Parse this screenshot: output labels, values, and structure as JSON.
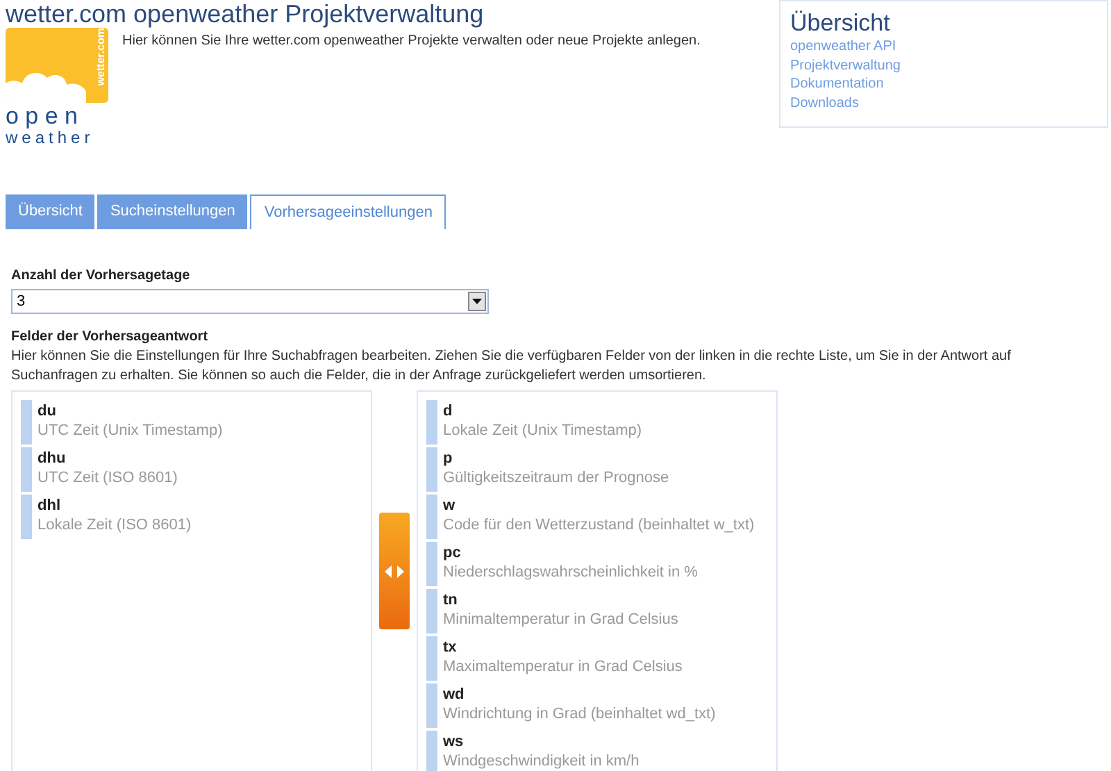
{
  "header": {
    "title": "wetter.com openweather Projektverwaltung",
    "intro": "Hier können Sie Ihre wetter.com openweather Projekte verwalten oder neue Projekte anlegen.",
    "logo": {
      "side_text": "wetter.com",
      "line_1": "o p e n",
      "line_2": "weather"
    }
  },
  "overview": {
    "title": "Übersicht",
    "links": [
      "openweather API",
      "Projektverwaltung",
      "Dokumentation",
      "Downloads"
    ]
  },
  "tabs": [
    {
      "label": "Übersicht",
      "selected": false
    },
    {
      "label": "Sucheinstellungen",
      "selected": false
    },
    {
      "label": "Vorhersageeinstellungen",
      "selected": true
    }
  ],
  "days": {
    "label": "Anzahl der Vorhersagetage",
    "value": "3"
  },
  "fields": {
    "title": "Felder der Vorhersageantwort",
    "description": "Hier können Sie die Einstellungen für Ihre Suchabfragen bearbeiten. Ziehen Sie die verfügbaren Felder von der linken in die rechte Liste, um Sie in der Antwort auf Suchanfragen zu erhalten. Sie können so auch die Felder, die in der Anfrage zurückgeliefert werden umsortieren.",
    "available": [
      {
        "code": "du",
        "label": "UTC Zeit (Unix Timestamp)"
      },
      {
        "code": "dhu",
        "label": "UTC Zeit (ISO 8601)"
      },
      {
        "code": "dhl",
        "label": "Lokale Zeit (ISO 8601)"
      }
    ],
    "chosen": [
      {
        "code": "d",
        "label": "Lokale Zeit (Unix Timestamp)"
      },
      {
        "code": "p",
        "label": "Gültigkeitszeitraum der Prognose"
      },
      {
        "code": "w",
        "label": "Code für den Wetterzustand (beinhaltet w_txt)"
      },
      {
        "code": "pc",
        "label": "Niederschlagswahrscheinlichkeit in %"
      },
      {
        "code": "tn",
        "label": "Minimaltemperatur in Grad Celsius"
      },
      {
        "code": "tx",
        "label": "Maximaltemperatur in Grad Celsius"
      },
      {
        "code": "wd",
        "label": "Windrichtung in Grad (beinhaltet wd_txt)"
      },
      {
        "code": "ws",
        "label": "Windgeschwindigkeit in km/h"
      }
    ]
  }
}
